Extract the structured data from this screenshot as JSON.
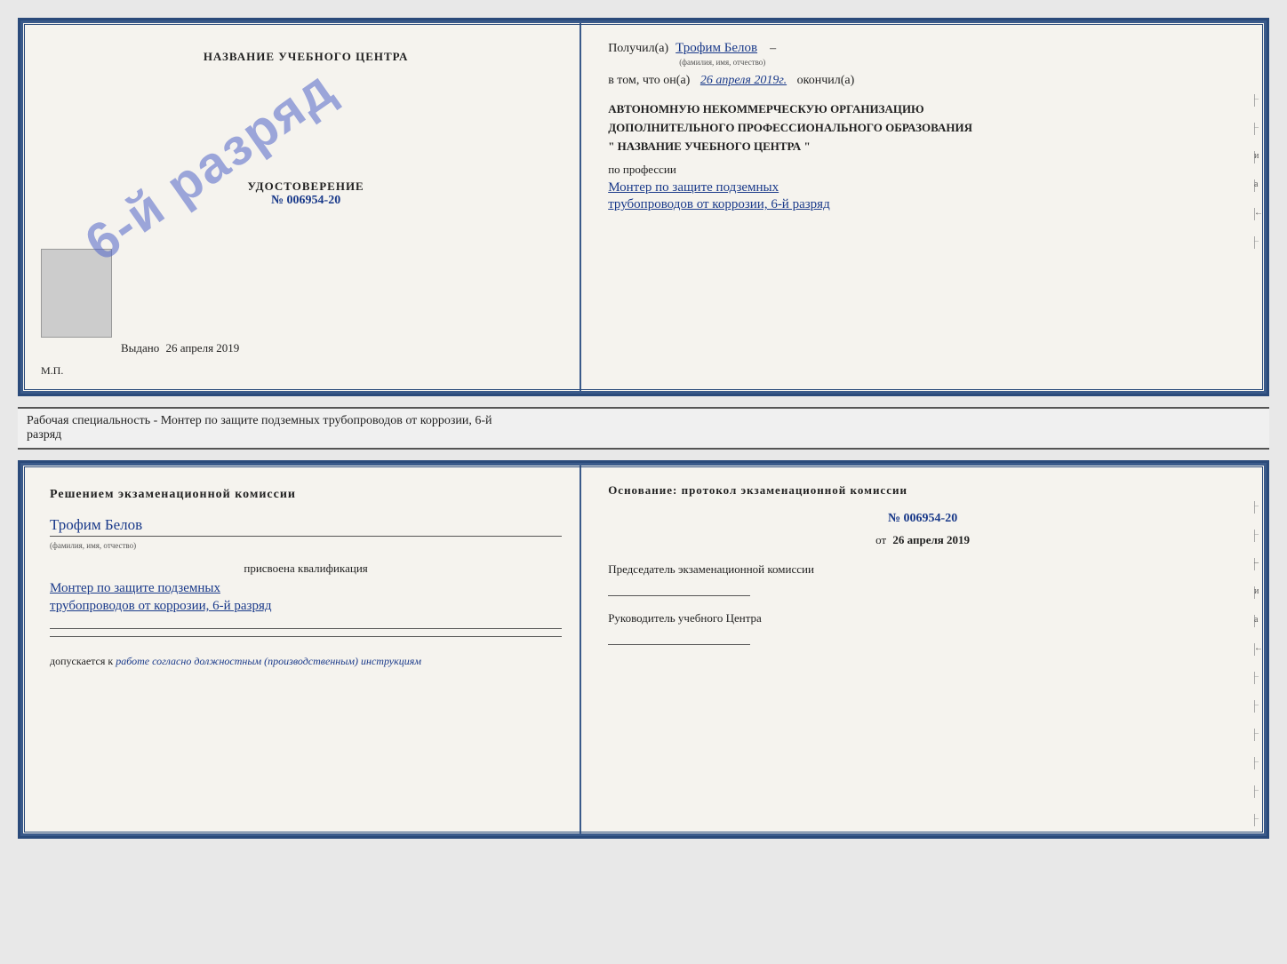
{
  "cert_top": {
    "left": {
      "title_label": "НАЗВАНИЕ УЧЕБНОГО ЦЕНТРА",
      "stamp_text": "6-й разряд",
      "udost_label": "УДОСТОВЕРЕНИЕ",
      "udost_number": "№ 006954-20",
      "vydano_label": "Выдано",
      "vydano_date": "26 апреля 2019",
      "mp_label": "М.П."
    },
    "right": {
      "received_label": "Получил(а)",
      "person_name": "Трофим Белов",
      "fio_sublabel": "(фамилия, имя, отчество)",
      "dash1": "–",
      "date_prefix": "в том, что он(а)",
      "date_value": "26 апреля 2019г.",
      "date_italic": true,
      "finished_label": "окончил(а)",
      "org_line1": "АВТОНОМНУЮ НЕКОММЕРЧЕСКУЮ ОРГАНИЗАЦИЮ",
      "org_line2": "ДОПОЛНИТЕЛЬНОГО ПРОФЕССИОНАЛЬНОГО ОБРАЗОВАНИЯ",
      "org_line3": "\" НАЗВАНИЕ УЧЕБНОГО ЦЕНТРА \"",
      "profession_label": "по профессии",
      "profession_line1": "Монтер по защите подземных",
      "profession_line2": "трубопроводов от коррозии, 6-й разряд"
    }
  },
  "middle_text": {
    "line1": "Рабочая специальность - Монтер по защите подземных трубопроводов от коррозии, 6-й",
    "line2": "разряд"
  },
  "cert_bottom": {
    "left": {
      "komissia_title": "Решением экзаменационной комиссии",
      "person_name": "Трофим Белов",
      "fio_sublabel": "(фамилия, имя, отчество)",
      "assigned_label": "присвоена квалификация",
      "qualification_line1": "Монтер по защите подземных",
      "qualification_line2": "трубопроводов от коррозии, 6-й разряд",
      "dopuskaetsya_label": "допускается к",
      "dopuskaetsya_val": "работе согласно должностным (производственным) инструкциям"
    },
    "right": {
      "osnov_title": "Основание: протокол экзаменационной комиссии",
      "protocol_number": "№ 006954-20",
      "from_prefix": "от",
      "from_date": "26 апреля 2019",
      "predsed_label": "Председатель экзаменационной комиссии",
      "ruk_label": "Руководитель учебного Центра"
    }
  }
}
